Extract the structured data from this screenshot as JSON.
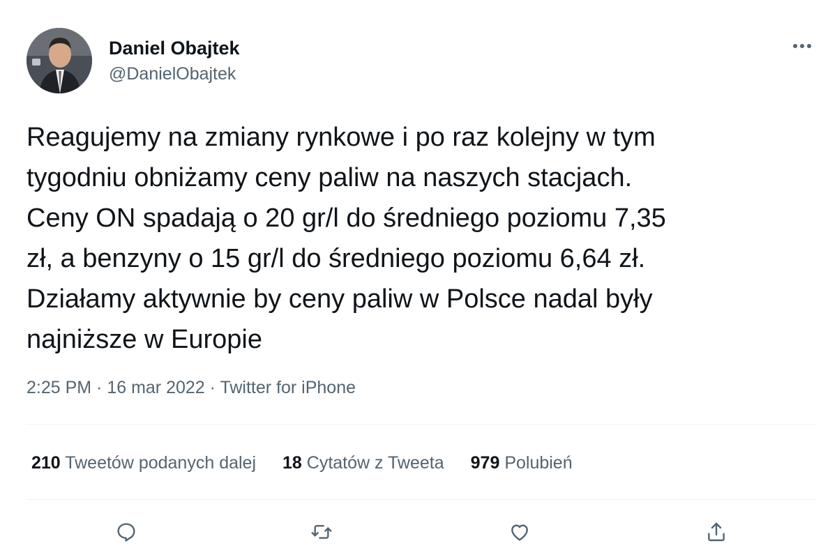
{
  "author": {
    "display_name": "Daniel Obajtek",
    "handle": "@DanielObajtek"
  },
  "tweet": {
    "text": "Reagujemy na zmiany rynkowe i po raz kolejny w tym\ntygodniu obniżamy ceny paliw na naszych stacjach.\nCeny ON spadają o 20 gr/l do średniego poziomu 7,35\nzł, a benzyny o 15 gr/l do średniego poziomu 6,64 zł.\nDziałamy aktywnie by ceny paliw w Polsce nadal były\nnajniższe w Europie",
    "time": "2:25 PM",
    "date": "16 mar 2022",
    "separator": " · ",
    "source": "Twitter for iPhone"
  },
  "stats": {
    "retweets": {
      "count": "210",
      "label": "Tweetów podanych dalej"
    },
    "quotes": {
      "count": "18",
      "label": "Cytatów z Tweeta"
    },
    "likes": {
      "count": "979",
      "label": "Polubień"
    }
  },
  "icons": {
    "more": "more-horizontal-icon",
    "reply": "reply-icon",
    "retweet": "retweet-icon",
    "like": "heart-icon",
    "share": "share-icon"
  },
  "colors": {
    "text_primary": "#0f1419",
    "text_secondary": "#536471",
    "divider": "#eff3f4"
  }
}
